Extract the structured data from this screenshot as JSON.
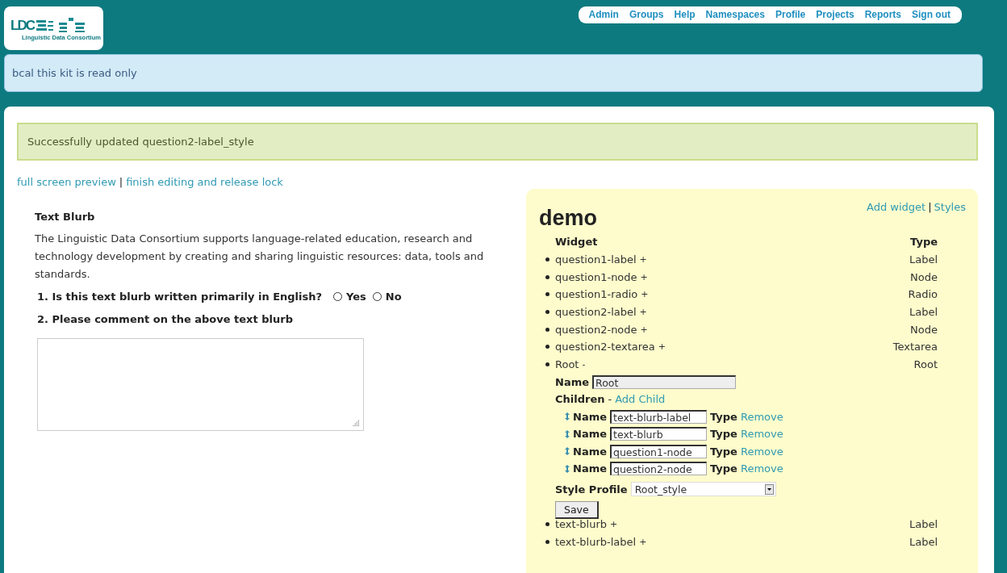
{
  "logo": {
    "mark": "LDC",
    "caption": "Linguistic Data Consortium"
  },
  "nav": [
    "Admin",
    "Groups",
    "Help",
    "Namespaces",
    "Profile",
    "Projects",
    "Reports",
    "Sign out"
  ],
  "notice": "bcal this kit is read only",
  "flash": "Successfully updated question2-label_style",
  "links": {
    "preview": "full screen preview",
    "separator": "|",
    "finish": "finish editing and release lock"
  },
  "preview": {
    "heading": "Text Blurb",
    "blurb": "The Linguistic Data Consortium supports language-related education, research and technology development by creating and sharing linguistic resources: data, tools and standards.",
    "questions": [
      {
        "kind": "radio",
        "label": "1. Is this text blurb written primarily in English?",
        "options": [
          {
            "label": "Yes",
            "selected": false
          },
          {
            "label": "No",
            "selected": false
          }
        ]
      },
      {
        "kind": "textarea",
        "label": "2. Please comment on the above text blurb"
      }
    ]
  },
  "kit": {
    "title": "demo",
    "add_widget": "Add widget",
    "separator": "|",
    "styles": "Styles",
    "columns": [
      "Widget",
      "Type"
    ],
    "widgets": [
      {
        "name": "question1-label",
        "toggle": "+",
        "type": "Label"
      },
      {
        "name": "question1-node",
        "toggle": "+",
        "type": "Node"
      },
      {
        "name": "question1-radio",
        "toggle": "+",
        "type": "Radio"
      },
      {
        "name": "question2-label",
        "toggle": "+",
        "type": "Label"
      },
      {
        "name": "question2-node",
        "toggle": "+",
        "type": "Node"
      },
      {
        "name": "question2-textarea",
        "toggle": "+",
        "type": "Textarea"
      },
      {
        "name": "Root",
        "toggle": "-",
        "type": "Root",
        "editor": {
          "name_label": "Name",
          "name_value": "Root",
          "children_label": "Children",
          "children_separator": "-",
          "add_child": "Add Child",
          "children": [
            {
              "label": "Name",
              "value": "text-blurb-label",
              "type_label": "Type",
              "remove": "Remove"
            },
            {
              "label": "Name",
              "value": "text-blurb",
              "type_label": "Type",
              "remove": "Remove"
            },
            {
              "label": "Name",
              "value": "question1-node",
              "type_label": "Type",
              "remove": "Remove"
            },
            {
              "label": "Name",
              "value": "question2-node",
              "type_label": "Type",
              "remove": "Remove"
            }
          ],
          "style_label": "Style Profile",
          "style_value": "Root_style",
          "save": "Save"
        }
      },
      {
        "name": "text-blurb",
        "toggle": "+",
        "type": "Label"
      },
      {
        "name": "text-blurb-label",
        "toggle": "+",
        "type": "Label"
      }
    ]
  }
}
